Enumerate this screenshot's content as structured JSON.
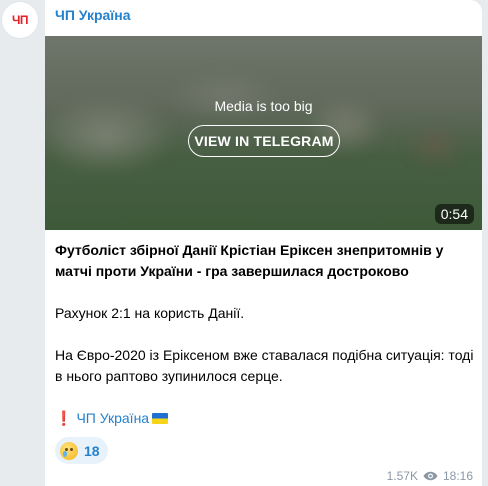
{
  "channel": {
    "name": "ЧП Україна",
    "avatar_text": "ЧП"
  },
  "media": {
    "notice": "Media is too big",
    "button_label": "VIEW IN TELEGRAM",
    "duration": "0:54"
  },
  "post": {
    "headline": "Футболіст збірної Данії Крістіан Еріксен знепритомнів у матчі проти України - гра завершилася достроково",
    "paragraph_1": "Рахунок 2:1 на користь Данії.",
    "paragraph_2": "На Євро-2020 із Еріксеном вже ставалася подібна ситуація: тоді в нього раптово зупинилося серце.",
    "signature_mark": "❗",
    "signature_link": "ЧП Україна"
  },
  "reaction": {
    "icon": "crying-face-icon",
    "count": "18"
  },
  "footer": {
    "views": "1.57K",
    "time": "18:16"
  },
  "colors": {
    "accent": "#2481cc",
    "brand_red": "#e31e24",
    "meta_gray": "#8b98a5",
    "background": "#e7ebee"
  }
}
